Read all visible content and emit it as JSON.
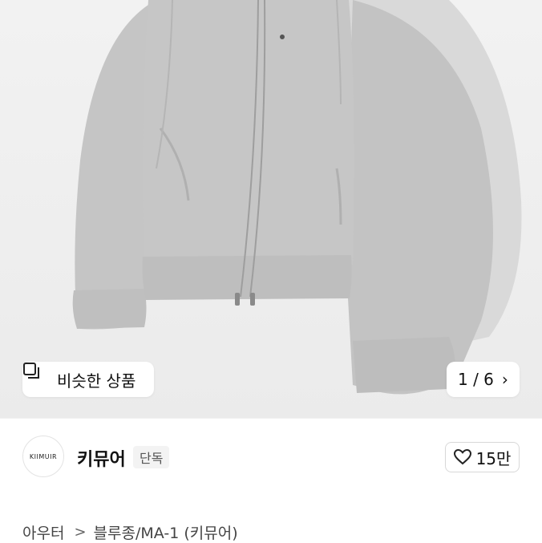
{
  "hero": {
    "image_alt": "gray zip-up hoodie jacket",
    "similar_button": {
      "icon": "similar-items-icon",
      "label": "비슷한 상품"
    },
    "counter": {
      "current": "1",
      "total": "6",
      "text": "1 / 6",
      "chevron": "chevron-right-icon"
    }
  },
  "brand": {
    "logo_text": "KIIMUIR",
    "name": "키뮤어",
    "badge": "단독"
  },
  "like": {
    "icon": "heart-icon",
    "count": "15만"
  },
  "breadcrumb": {
    "items": [
      "아우터",
      "블루종/MA-1 (키뮤어)"
    ],
    "separator": ">"
  },
  "colors": {
    "hero_bg": "#eeeeee",
    "garment": "#c4c4c4",
    "text": "#111111"
  }
}
